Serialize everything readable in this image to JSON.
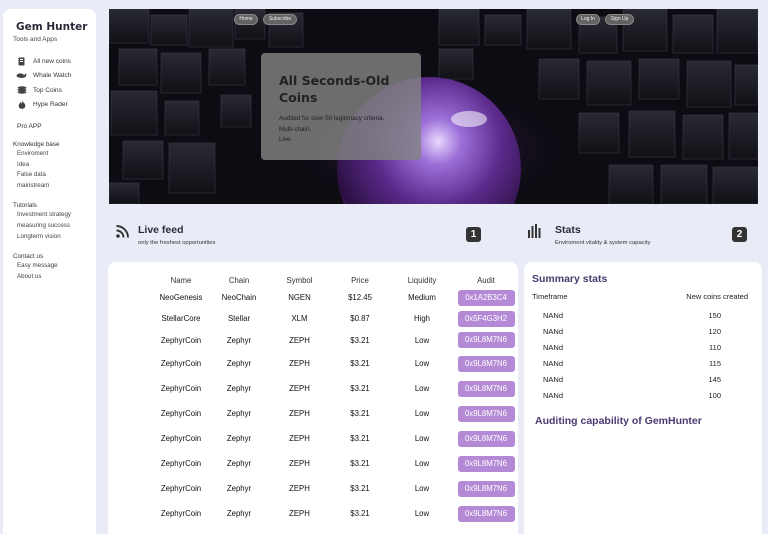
{
  "sidebar": {
    "brand": "Gem Hunter",
    "subtitle": "Tools and Apps",
    "nav": [
      {
        "label": "All new coins",
        "icon": "clipboard-icon"
      },
      {
        "label": "Whale Watch",
        "icon": "whale-icon"
      },
      {
        "label": "Top Coins",
        "icon": "coins-icon"
      },
      {
        "label": "Hype Rader",
        "icon": "flame-icon"
      }
    ],
    "pro": "Pro APP",
    "sections": [
      {
        "title": "Knowledge base",
        "items": [
          "Enviroment",
          "Idea",
          "False data",
          "mainstream"
        ]
      },
      {
        "title": "Tutorials",
        "items": [
          "Investment strategy",
          "measuring success",
          "Longterm vision"
        ]
      },
      {
        "title": "Contact us",
        "items": [
          "Easy message",
          "About us"
        ]
      }
    ]
  },
  "hero": {
    "home": "Home",
    "subscribe": "Subscribe",
    "login": "Log In",
    "signup": "Sign Up",
    "title": "All Seconds-Old Coins",
    "lines": [
      "Audited for over 50 legitimacy criteria.",
      "Multi-chain.",
      "Live."
    ]
  },
  "feed": {
    "title": "Live feed",
    "subtitle": "only the freshest opportunities",
    "badge": "1",
    "headers": [
      "Name",
      "Chain",
      "Symbol",
      "Price",
      "Liquidity",
      "Audit"
    ],
    "rows": [
      [
        "NeoGenesis",
        "NeoChain",
        "NGEN",
        "$12.45",
        "Medium",
        "0x1A2B3C4"
      ],
      [
        "StellarCore",
        "Stellar",
        "XLM",
        "$0.87",
        "High",
        "0x5F4G3H2"
      ],
      [
        "ZephyrCoin",
        "Zephyr",
        "ZEPH",
        "$3.21",
        "Low",
        "0x9L8M7N6"
      ],
      [
        "ZephyrCoin",
        "Zephyr",
        "ZEPH",
        "$3.21",
        "Low",
        "0x9L8M7N6"
      ],
      [
        "ZephyrCoin",
        "Zephyr",
        "ZEPH",
        "$3.21",
        "Low",
        "0x9L8M7N6"
      ],
      [
        "ZephyrCoin",
        "Zephyr",
        "ZEPH",
        "$3.21",
        "Low",
        "0x9L8M7N6"
      ],
      [
        "ZephyrCoin",
        "Zephyr",
        "ZEPH",
        "$3.21",
        "Low",
        "0x9L8M7N6"
      ],
      [
        "ZephyrCoin",
        "Zephyr",
        "ZEPH",
        "$3.21",
        "Low",
        "0x9L8M7N6"
      ],
      [
        "ZephyrCoin",
        "Zephyr",
        "ZEPH",
        "$3.21",
        "Low",
        "0x9L8M7N6"
      ],
      [
        "ZephyrCoin",
        "Zephyr",
        "ZEPH",
        "$3.21",
        "Low",
        "0x9L8M7N6"
      ]
    ]
  },
  "stats": {
    "title": "Stats",
    "subtitle": "Enviroment vitality & system capacity",
    "badge": "2",
    "summary_title": "Summary stats",
    "col_timeframe": "Timeframe",
    "col_new": "New coins created",
    "rows": [
      {
        "timeframe": "NANd",
        "value": "150"
      },
      {
        "timeframe": "NANd",
        "value": "120"
      },
      {
        "timeframe": "NANd",
        "value": "110"
      },
      {
        "timeframe": "NANd",
        "value": "115"
      },
      {
        "timeframe": "NANd",
        "value": "145"
      },
      {
        "timeframe": "NANd",
        "value": "100"
      }
    ],
    "audit_title": "Auditing capability of GemHunter"
  },
  "colors": {
    "accent": "#b48ad6",
    "heading": "#4a3a70",
    "background": "#e9ecf6"
  }
}
